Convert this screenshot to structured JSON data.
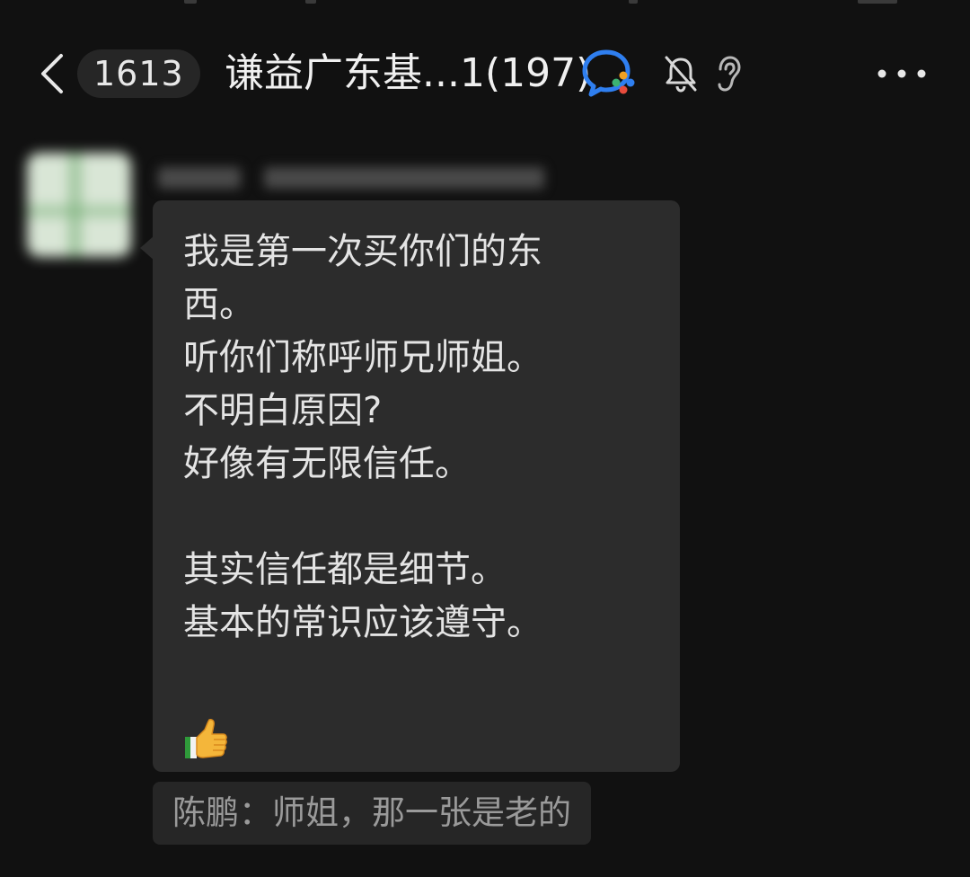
{
  "header": {
    "unread_count": "1613",
    "title": "谦益广东基...1(197)",
    "icons": {
      "back": "chevron-left-icon",
      "wecom": "wecom-group-icon",
      "mute": "bell-off-icon",
      "earpiece": "ear-icon",
      "more": "more-dots-icon"
    }
  },
  "message": {
    "lines": [
      "我是第一次买你们的东",
      "西。",
      "听你们称呼师兄师姐。",
      "不明白原因?",
      "好像有无限信任。",
      "其实信任都是细节。",
      "基本的常识应该遵守。"
    ],
    "emoji": "thumbs-up-icon"
  },
  "quote": {
    "text": "陈鹏：师姐，那一张是老的"
  },
  "colors": {
    "background": "#111111",
    "bubble": "#2c2c2c",
    "quote_bg": "#262626",
    "text": "#e4e4e4",
    "quote_text": "#9a9a9a",
    "wecom_blue": "#2f7ff0"
  }
}
